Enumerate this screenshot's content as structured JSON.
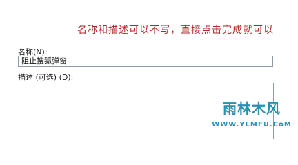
{
  "annotation": {
    "text": "名称和描述可以不写，直接点击完成就可以"
  },
  "form": {
    "name_label": "名称(N):",
    "name_value": "阻止搜狐弹窗",
    "description_label": "描述 (可选) (D):",
    "description_value": ""
  },
  "watermark": {
    "title": "雨林木风",
    "url": "WWW.YLMFU.CoM"
  },
  "colors": {
    "annotation": "#b3262a",
    "watermark": "#2a8fb3",
    "field_border": "#8f9aa6"
  }
}
